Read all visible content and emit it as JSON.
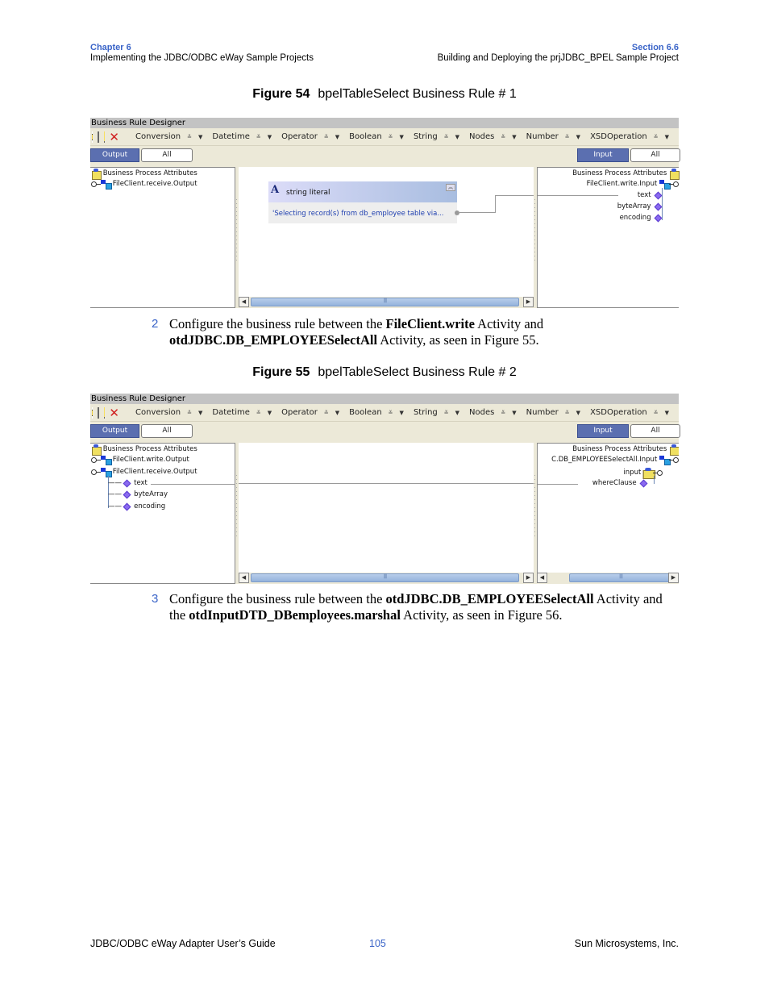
{
  "header": {
    "chapter_label": "Chapter 6",
    "chapter_title": "Implementing the JDBC/ODBC eWay Sample Projects",
    "section_label": "Section 6.6",
    "section_title": "Building and Deploying the prjJDBC_BPEL Sample Project"
  },
  "figures": [
    {
      "number": "Figure 54",
      "title": "bpelTableSelect Business Rule # 1",
      "designer": {
        "title": "Business Rule Designer",
        "menus": [
          "Conversion",
          "Datetime",
          "Operator",
          "Boolean",
          "String",
          "Nodes",
          "Number",
          "XSDOperation"
        ],
        "left_tabs": [
          "Output",
          "All"
        ],
        "right_tabs": [
          "Input",
          "All"
        ],
        "left_tree": [
          "Business Process Attributes",
          "FileClient.receive.Output"
        ],
        "right_tree": [
          "Business Process Attributes",
          "FileClient.write.Input",
          "text",
          "byteArray",
          "encoding"
        ],
        "literal_box": {
          "title": "string literal",
          "value": "'Selecting record(s) from db_employee table via..."
        }
      }
    },
    {
      "number": "Figure 55",
      "title": "bpelTableSelect Business Rule # 2",
      "designer": {
        "title": "Business Rule Designer",
        "menus": [
          "Conversion",
          "Datetime",
          "Operator",
          "Boolean",
          "String",
          "Nodes",
          "Number",
          "XSDOperation"
        ],
        "left_tabs": [
          "Output",
          "All"
        ],
        "right_tabs": [
          "Input",
          "All"
        ],
        "left_tree": [
          "Business Process Attributes",
          "FileClient.write.Output",
          "FileClient.receive.Output",
          "text",
          "byteArray",
          "encoding"
        ],
        "right_tree": [
          "Business Process Attributes",
          "C.DB_EMPLOYEESelectAll.Input",
          "input",
          "whereClause"
        ]
      }
    }
  ],
  "steps": [
    {
      "number": "2",
      "parts": [
        "Configure the business rule between the ",
        "FileClient.write",
        " Activity and ",
        "otdJDBC.DB_EMPLOYEESelectAll",
        " Activity, as seen in Figure 55."
      ]
    },
    {
      "number": "3",
      "parts": [
        "Configure the business rule between the ",
        "otdJDBC.DB_EMPLOYEESelectAll",
        " Activity and the ",
        "otdInputDTD_DBemployees.marshal",
        " Activity, as seen in Figure 56."
      ]
    }
  ],
  "footer": {
    "guide_title": "JDBC/ODBC eWay Adapter User’s Guide",
    "page_number": "105",
    "company": "Sun Microsystems, Inc."
  },
  "colors": {
    "accent_blue": "#3a64c8",
    "active_tab": "#5b6fb0",
    "scroll_thumb": "#94b2dc",
    "diamond": "#8a6af0"
  }
}
